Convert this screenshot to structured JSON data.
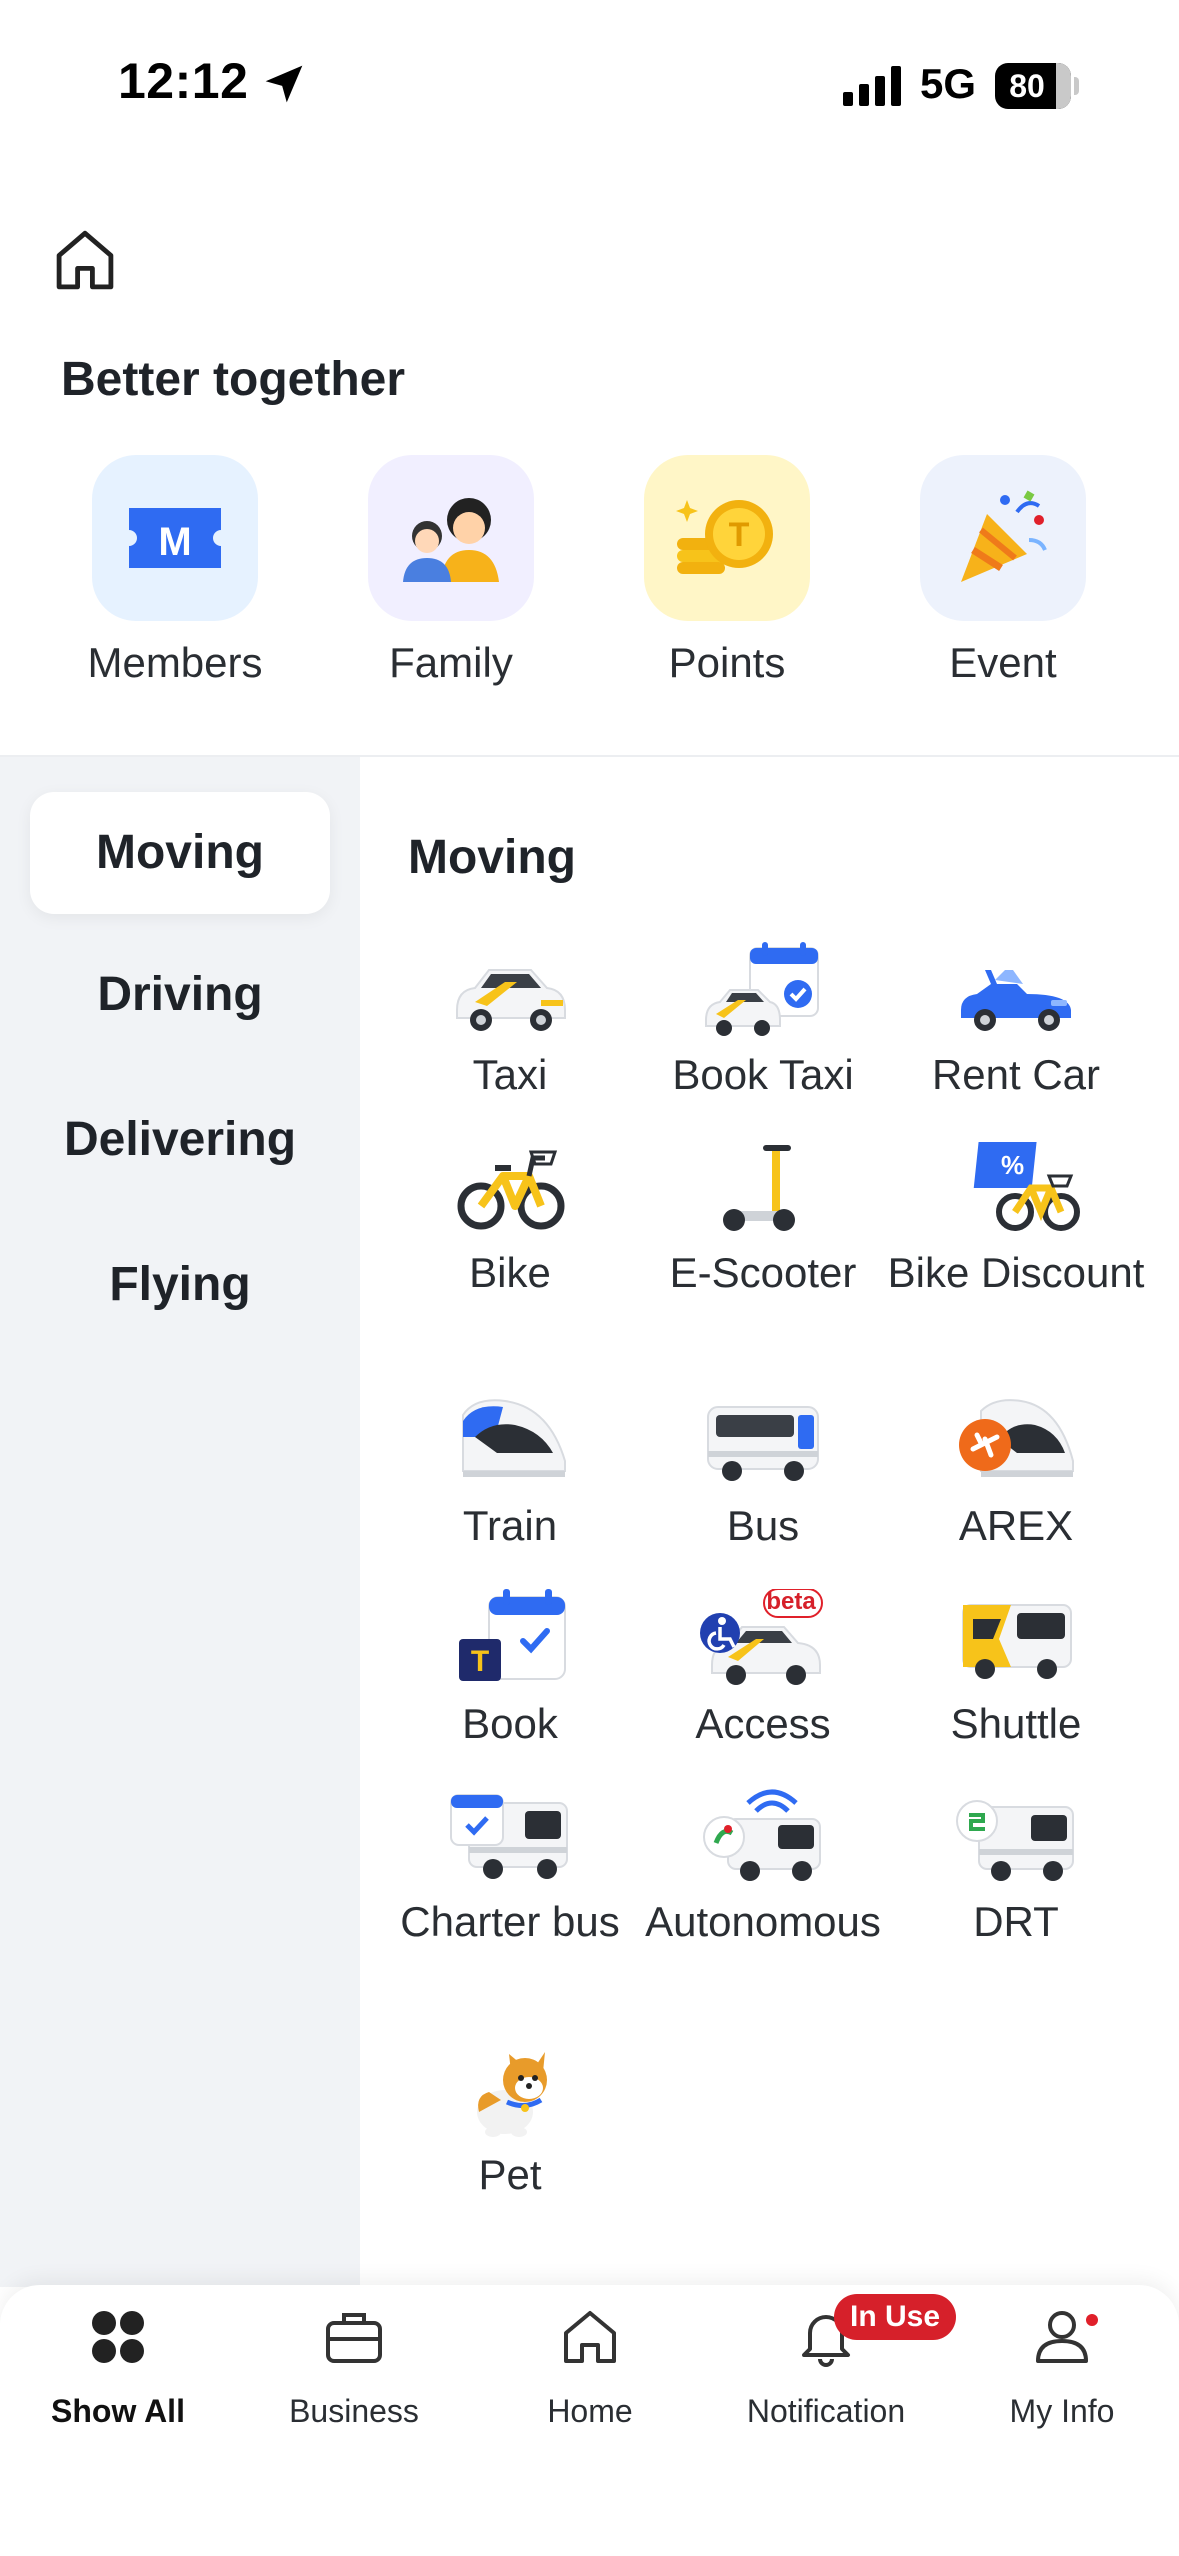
{
  "status": {
    "time": "12:12",
    "network": "5G",
    "battery": "80",
    "battery_level": 0.8
  },
  "header": {
    "section_title": "Better together"
  },
  "quick": [
    {
      "label": "Members",
      "icon": "members-icon",
      "bg": "#e6f2ff"
    },
    {
      "label": "Family",
      "icon": "family-icon",
      "bg": "#f1efff"
    },
    {
      "label": "Points",
      "icon": "points-icon",
      "bg": "#fff6c7"
    },
    {
      "label": "Event",
      "icon": "party-popper-icon",
      "bg": "#edf2fc"
    }
  ],
  "rail": {
    "items": [
      {
        "label": "Moving",
        "active": true
      },
      {
        "label": "Driving"
      },
      {
        "label": "Delivering"
      },
      {
        "label": "Flying"
      }
    ]
  },
  "main": {
    "title": "Moving",
    "services": [
      {
        "label": "Taxi",
        "icon": "taxi-icon"
      },
      {
        "label": "Book Taxi",
        "icon": "book-taxi-icon"
      },
      {
        "label": "Rent Car",
        "icon": "rent-car-icon"
      },
      {
        "label": "Bike",
        "icon": "bike-icon"
      },
      {
        "label": "E-Scooter",
        "icon": "e-scooter-icon"
      },
      {
        "label": "Bike Discount",
        "icon": "bike-discount-icon"
      },
      {
        "label": "Train",
        "icon": "train-icon"
      },
      {
        "label": "Bus",
        "icon": "bus-icon"
      },
      {
        "label": "AREX",
        "icon": "arex-icon"
      },
      {
        "label": "Book",
        "icon": "book-icon"
      },
      {
        "label": "Access",
        "icon": "access-icon",
        "tag": "beta"
      },
      {
        "label": "Shuttle",
        "icon": "shuttle-icon"
      },
      {
        "label": "Charter bus",
        "icon": "charter-bus-icon"
      },
      {
        "label": "Autonomous",
        "icon": "autonomous-icon"
      },
      {
        "label": "DRT",
        "icon": "drt-icon"
      },
      {
        "label": "Pet",
        "icon": "pet-icon"
      }
    ]
  },
  "tabs": [
    {
      "label": "Show All",
      "icon": "grid-icon",
      "active": true
    },
    {
      "label": "Business",
      "icon": "briefcase-icon"
    },
    {
      "label": "Home",
      "icon": "home-icon"
    },
    {
      "label": "Notification",
      "icon": "bell-icon",
      "badge": "In Use"
    },
    {
      "label": "My Info",
      "icon": "person-icon"
    }
  ],
  "colors": {
    "accent_blue": "#2f6bf2",
    "accent_yellow": "#f7c31a",
    "badge_red": "#d6202a",
    "rail_bg": "#f1f3f6"
  }
}
